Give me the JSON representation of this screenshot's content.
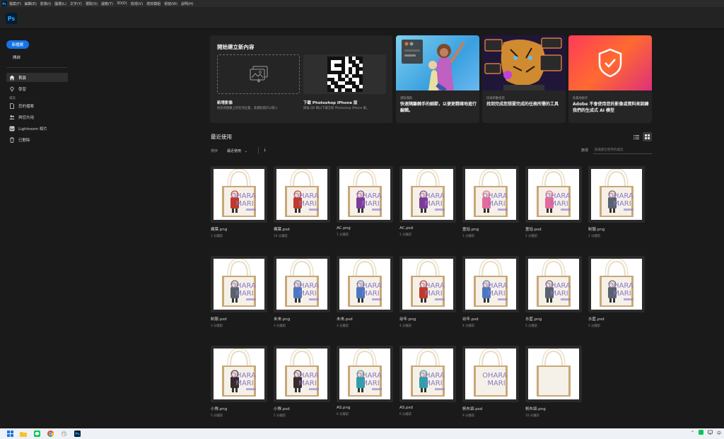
{
  "menubar": {
    "app_icon": "Ps",
    "items": [
      "檔案(F)",
      "編輯(E)",
      "影像(I)",
      "圖層(L)",
      "文字(Y)",
      "選取(S)",
      "濾鏡(T)",
      "3D(D)",
      "檢視(V)",
      "增效模組",
      "視窗(W)",
      "說明(H)"
    ]
  },
  "appbar": {
    "logo": "Ps"
  },
  "sidebar": {
    "new_button": "新檔案",
    "open_label": "開啟",
    "home": "首頁",
    "learn": "學習",
    "files_section": "檔案",
    "your_files": "您的檔案",
    "shared": "與您共用",
    "lightroom": "Lightroom 相片",
    "deleted": "已刪除"
  },
  "create": {
    "title": "開始建立新內容",
    "new_image_title": "新增影像",
    "new_image_desc": "拖放到螢幕上的任何位置，或選取圖示以匯入",
    "iphone_title": "下載 Photoshop iPhone 版",
    "iphone_desc": "掃描 QR 碼以下載全新 Photoshop iPhone 版。"
  },
  "promos": [
    {
      "category": "選取擷取",
      "title": "快速隔離棘手的細節，以便更精確地進行編輯。"
    },
    {
      "category": "快速移動指南",
      "title": "找到完成您想要完成的任務所需的工具"
    },
    {
      "category": "負責地創作",
      "title": "Adobe 不會使用您的影像或資料來訓練我們的生成式 AI 模型"
    }
  ],
  "recent": {
    "title": "最近使用",
    "sort_label": "排序",
    "sort_value": "最近使用",
    "sort_direction": "↓",
    "filter_label": "篩選",
    "filter_placeholder": "篩選最近使用的檔案"
  },
  "files": [
    {
      "name": "楓葉.png",
      "time": "1 分鐘前",
      "variant": "red"
    },
    {
      "name": "楓葉.psd",
      "time": "10 分鐘前",
      "variant": "red"
    },
    {
      "name": "AC.png",
      "time": "1 分鐘前",
      "variant": "purple"
    },
    {
      "name": "AC.psd",
      "time": "1 分鐘前",
      "variant": "purple"
    },
    {
      "name": "童話.png",
      "time": "1 分鐘前",
      "variant": "pink"
    },
    {
      "name": "童話.psd",
      "time": "2 分鐘前",
      "variant": "pink"
    },
    {
      "name": "制服.png",
      "time": "2 分鐘前",
      "variant": "gray"
    },
    {
      "name": "制服.psd",
      "time": "3 分鐘前",
      "variant": "gray"
    },
    {
      "name": "未來.png",
      "time": "3 分鐘前",
      "variant": "blue"
    },
    {
      "name": "未來.psd",
      "time": "3 分鐘前",
      "variant": "blue"
    },
    {
      "name": "幼年.png",
      "time": "4 分鐘前",
      "variant": "red"
    },
    {
      "name": "幼年.psd",
      "time": "4 分鐘前",
      "variant": "blue"
    },
    {
      "name": "水藍.png",
      "time": "5 分鐘前",
      "variant": "gray"
    },
    {
      "name": "水藍.psd",
      "time": "5 分鐘前",
      "variant": "gray"
    },
    {
      "name": "小隊.png",
      "time": "5 分鐘前",
      "variant": "dark"
    },
    {
      "name": "小隊.psd",
      "time": "5 分鐘前",
      "variant": "dark"
    },
    {
      "name": "AS.png",
      "time": "6 分鐘前",
      "variant": "teal"
    },
    {
      "name": "AS.psd",
      "time": "6 分鐘前",
      "variant": "teal"
    },
    {
      "name": "帆布袋.psd",
      "time": "9 分鐘前",
      "variant": "text"
    },
    {
      "name": "帆布袋.png",
      "time": "10 分鐘前",
      "variant": "blank"
    }
  ],
  "bag_text": {
    "line1": "OHARA",
    "line2": "MARI"
  },
  "colors": {
    "accent": "#1473e6",
    "ps_blue": "#31a8ff",
    "bag_text": "#8a7ac8",
    "red": "#c0392b",
    "purple": "#7d3c98",
    "pink": "#e86a9c",
    "gray": "#5a6270",
    "blue": "#4a78c0",
    "dark": "#3a2a2a",
    "teal": "#2f9fa8"
  },
  "taskbar": {
    "icons": [
      "windows-icon",
      "explorer-icon",
      "line-icon",
      "chrome-icon",
      "paint-icon",
      "photoshop-icon"
    ],
    "tray_lang": "中"
  }
}
